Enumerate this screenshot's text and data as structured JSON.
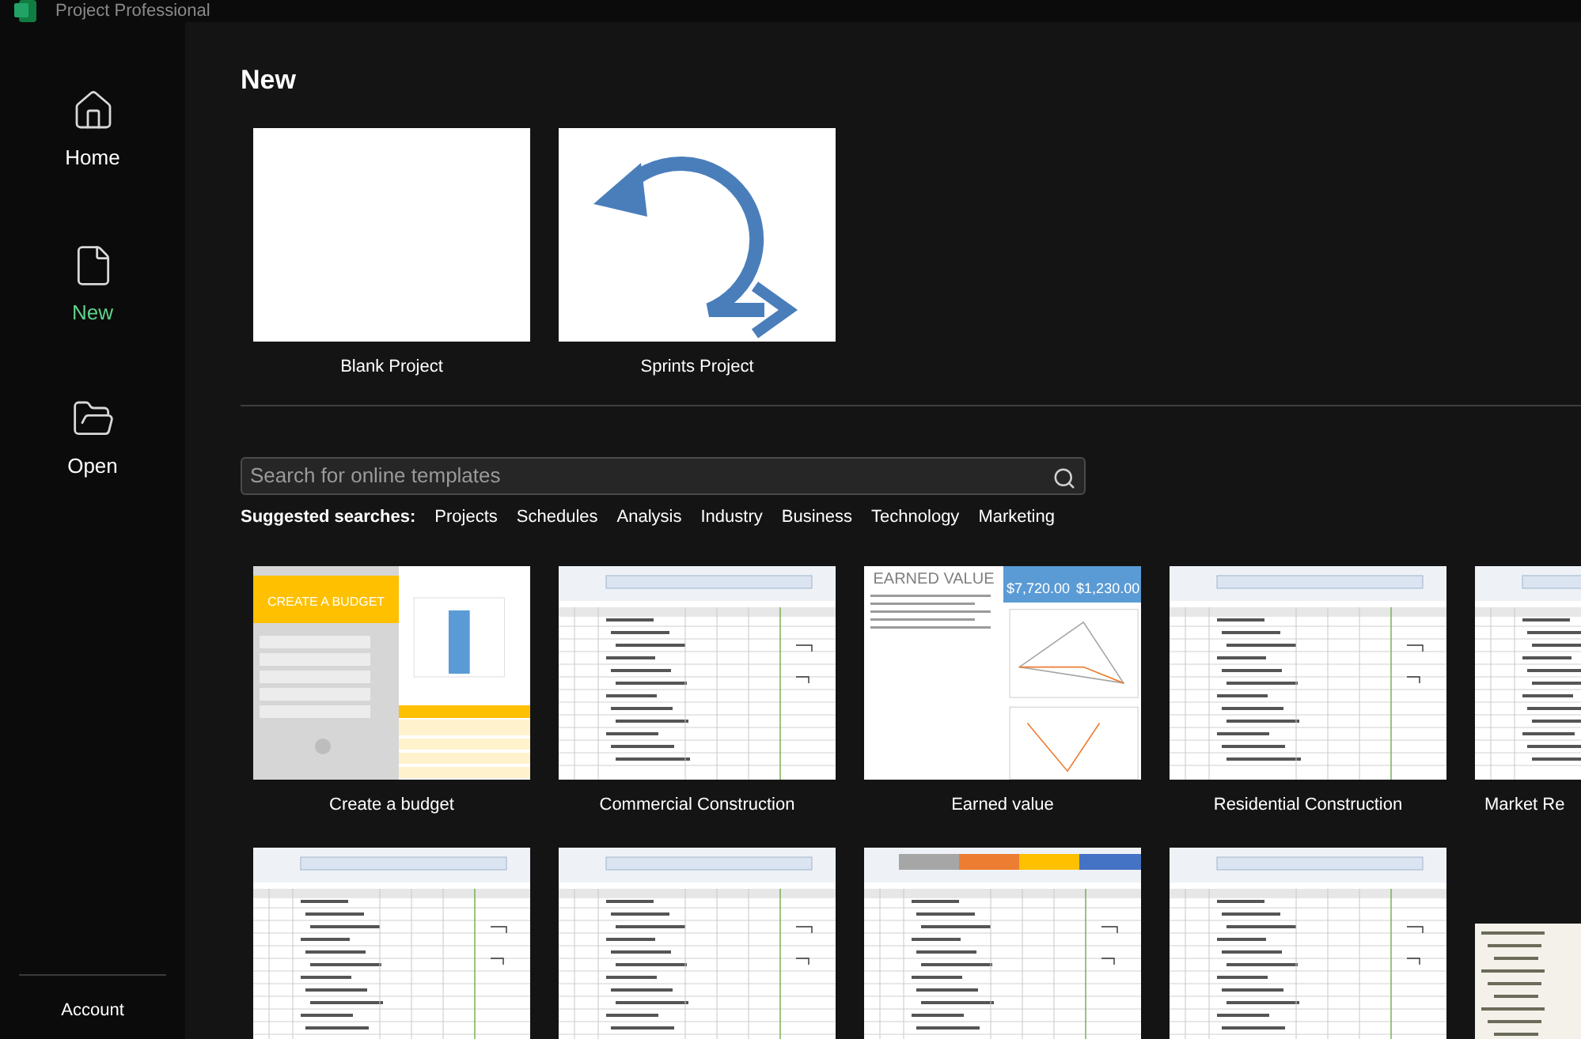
{
  "window": {
    "title": "Project Professional"
  },
  "nav": [
    {
      "label": "Home",
      "selected": false
    },
    {
      "label": "New",
      "selected": true
    },
    {
      "label": "Open",
      "selected": false
    }
  ],
  "account": "Account",
  "heading": "New",
  "featured": [
    {
      "label": "Blank Project",
      "kind": "blank"
    },
    {
      "label": "Sprints Project",
      "kind": "sprints"
    }
  ],
  "search": {
    "placeholder": "Search for online templates"
  },
  "suggested": {
    "label": "Suggested searches:",
    "items": [
      "Projects",
      "Schedules",
      "Analysis",
      "Industry",
      "Business",
      "Technology",
      "Marketing"
    ]
  },
  "templates": [
    {
      "label": "Create a budget",
      "kind": "budget",
      "banner": "CREATE A BUDGET"
    },
    {
      "label": "Commercial Construction",
      "kind": "gantt"
    },
    {
      "label": "Earned value",
      "kind": "earned",
      "banner": "EARNED VALUE",
      "figures": [
        "$7,720.00",
        "$1,230.00"
      ]
    },
    {
      "label": "Residential Construction",
      "kind": "gantt"
    },
    {
      "label": "Market Re",
      "kind": "gantt"
    }
  ],
  "templates_more": [
    {
      "kind": "gantt"
    },
    {
      "kind": "gantt"
    },
    {
      "kind": "phases"
    },
    {
      "kind": "gantt"
    },
    {
      "kind": "outline"
    }
  ]
}
